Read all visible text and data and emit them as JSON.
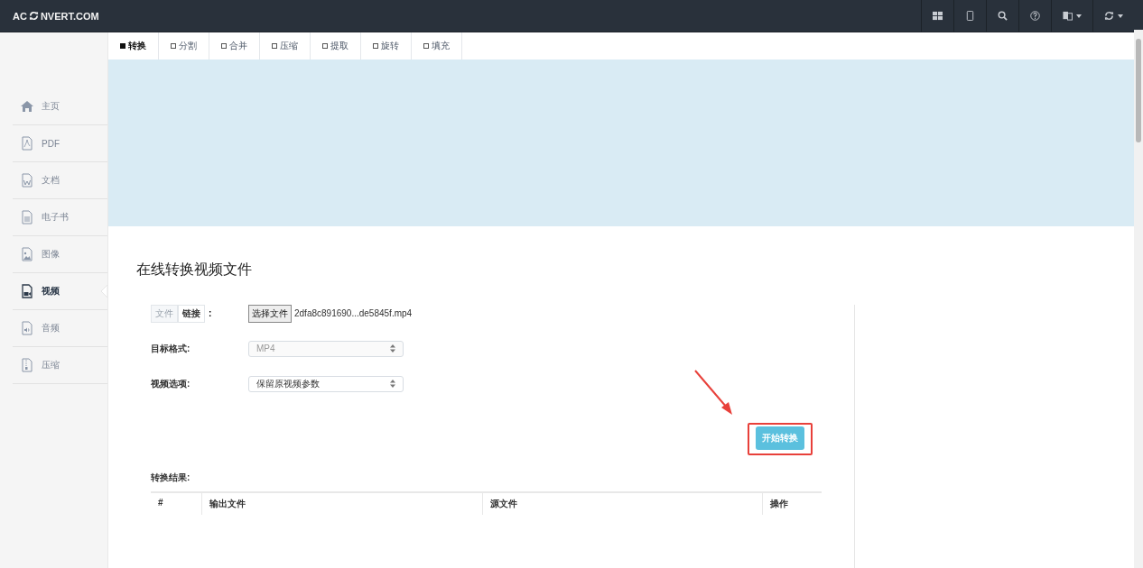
{
  "header": {
    "logo_left": "AC",
    "logo_right": "NVERT.COM",
    "tools": [
      {
        "kind": "grid"
      },
      {
        "kind": "tablet"
      },
      {
        "kind": "search"
      },
      {
        "kind": "help"
      },
      {
        "kind": "language",
        "caret": true
      },
      {
        "kind": "refresh",
        "caret": true
      }
    ]
  },
  "tabs": [
    {
      "label": "转换",
      "selected": true
    },
    {
      "label": "分割",
      "selected": false
    },
    {
      "label": "合并",
      "selected": false
    },
    {
      "label": "压缩",
      "selected": false
    },
    {
      "label": "提取",
      "selected": false
    },
    {
      "label": "旋转",
      "selected": false
    },
    {
      "label": "填充",
      "selected": false
    }
  ],
  "sidebar": {
    "items": [
      {
        "label": "主页",
        "kind": "home",
        "selected": false
      },
      {
        "label": "PDF",
        "kind": "pdf",
        "selected": false
      },
      {
        "label": "文档",
        "kind": "word",
        "selected": false
      },
      {
        "label": "电子书",
        "kind": "ebook",
        "selected": false
      },
      {
        "label": "图像",
        "kind": "image",
        "selected": false
      },
      {
        "label": "视频",
        "kind": "video",
        "selected": true
      },
      {
        "label": "音频",
        "kind": "audio",
        "selected": false
      },
      {
        "label": "压缩",
        "kind": "archive",
        "selected": false
      }
    ]
  },
  "main": {
    "title": "在线转换视频文件",
    "source_toggle": [
      {
        "label": "文件",
        "selected": false
      },
      {
        "label": "链接",
        "selected": true
      }
    ],
    "source_colon": ":",
    "file_button": "选择文件",
    "file_name": "2dfa8c891690...de5845f.mp4",
    "fields": [
      {
        "label": "目标格式:",
        "value": "MP4",
        "disabled": true
      },
      {
        "label": "视频选项:",
        "value": "保留原视频参数",
        "disabled": false
      }
    ],
    "start_button": "开始转换",
    "results_label": "转换结果:",
    "results_columns": [
      "#",
      "输出文件",
      "源文件",
      "操作"
    ]
  }
}
